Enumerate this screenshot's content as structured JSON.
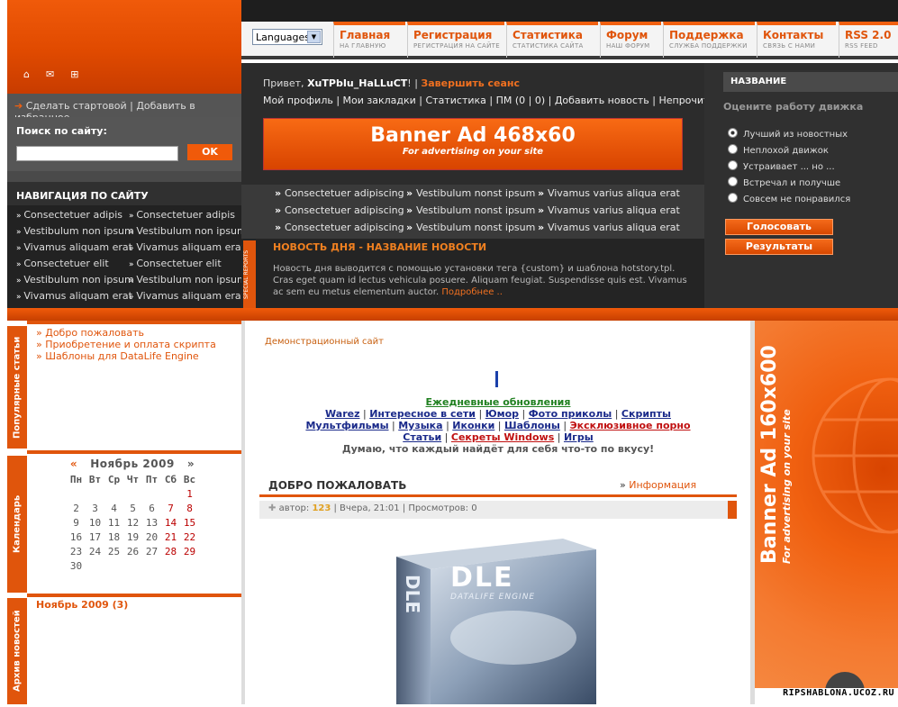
{
  "top_icons": [
    "⌂",
    "✉",
    "⊞"
  ],
  "languages": "Languages",
  "nav": [
    {
      "t": "Главная",
      "s": "НА ГЛАВНУЮ"
    },
    {
      "t": "Регистрация",
      "s": "РЕГИСТРАЦИЯ НА САЙТЕ"
    },
    {
      "t": "Статистика",
      "s": "СТАТИСТИКА САЙТА"
    },
    {
      "t": "Форум",
      "s": "НАШ ФОРУМ"
    },
    {
      "t": "Поддержка",
      "s": "СЛУЖБА ПОДДЕРЖКИ"
    },
    {
      "t": "Контакты",
      "s": "СВЯЗЬ С НАМИ"
    },
    {
      "t": "RSS 2.0",
      "s": "RSS FEED"
    }
  ],
  "fav": {
    "start": "Сделать стартовой",
    "sep": "|",
    "bookmark": "Добавить в избранное"
  },
  "search": {
    "label": "Поиск по сайту:",
    "ok": "OK"
  },
  "left_nav": {
    "title": "НАВИГАЦИЯ ПО САЙТУ",
    "links": [
      "Consectetuer adipis",
      "Consectetuer adipis",
      "Vestibulum non ipsum",
      "Vestibulum non ipsum",
      "Vivamus aliquam erat",
      "Vivamus aliquam erat",
      "Consectetuer elit",
      "Consectetuer elit",
      "Vestibulum non ipsum",
      "Vestibulum non ipsum",
      "Vivamus aliquam erat",
      "Vivamus aliquam erat"
    ]
  },
  "greet": {
    "hello": "Привет, ",
    "user": "XuTPbIu_HaLLuCT",
    "excl": "! | ",
    "logout": "Завершить сеанс"
  },
  "profile_links": "Мой профиль | Мои закладки | Статистика | ПМ (0 | 0) | Добавить новость | Непрочитанное",
  "banner468": {
    "title": "Banner Ad 468x60",
    "sub": "For advertising on your site"
  },
  "link_rows": [
    [
      "Consectetuer adipiscing",
      "Vestibulum nonst ipsum",
      "Vivamus varius aliqua erat"
    ],
    [
      "Consectetuer adipiscing",
      "Vestibulum nonst ipsum",
      "Vivamus varius aliqua erat"
    ],
    [
      "Consectetuer adipiscing",
      "Vestibulum nonst ipsum",
      "Vivamus varius aliqua erat"
    ]
  ],
  "special_tab": "SPECIAL REPORTS",
  "news": {
    "title": "НОВОСТЬ ДНЯ - НАЗВАНИЕ НОВОСТИ",
    "body": "Новость дня выводится с помощью установки тега {custom} и шаблона hotstory.tpl. Cras eget quam id lectus vehicula posuere. Aliquam feugiat. Suspendisse quis est. Vivamus ac sem eu metus elementum auctor. ",
    "more": "Подробнее .."
  },
  "poll": {
    "title": "НАЗВАНИЕ",
    "question": "Оцените работу движка",
    "options": [
      "Лучший из новостных",
      "Неплохой движок",
      "Устраивает ... но ...",
      "Встречал и получше",
      "Совсем не понравился"
    ],
    "vote": "Голосовать",
    "results": "Результаты"
  },
  "popular": {
    "tab": "Популярные статьи",
    "items": [
      "Добро пожаловать",
      "Приобретение и оплата скрипта",
      "Шаблоны для DataLife Engine"
    ]
  },
  "calendar": {
    "tab": "Календарь",
    "prev": "«",
    "month": "Ноябрь 2009",
    "next": "»",
    "days": [
      "Пн",
      "Вт",
      "Ср",
      "Чт",
      "Пт",
      "Сб",
      "Вс"
    ],
    "cells": [
      "",
      "",
      "",
      "",
      "",
      "",
      "1",
      "2",
      "3",
      "4",
      "5",
      "6",
      "7",
      "8",
      "9",
      "10",
      "11",
      "12",
      "13",
      "14",
      "15",
      "16",
      "17",
      "18",
      "19",
      "20",
      "21",
      "22",
      "23",
      "24",
      "25",
      "26",
      "27",
      "28",
      "29",
      "30",
      "",
      "",
      "",
      "",
      "",
      ""
    ]
  },
  "archive": {
    "tab": "Архив новостей",
    "link": "Ноябрь 2009 (3)"
  },
  "demo": "Демонстрационный сайт",
  "today": "Ежедневные обновления",
  "cat_rows": [
    [
      "Warez",
      "Интересное в сети",
      "Юмор",
      "Фото приколы",
      "Скрипты"
    ],
    [
      "Мультфильмы",
      "Музыка",
      "Иконки",
      "Шаблоны",
      "Эксклюзивное порно"
    ],
    [
      "Статьи",
      "Секреты Windows",
      "Игры"
    ]
  ],
  "think": "Думаю, что каждый найдёт для себя что-то по вкусу!",
  "post": {
    "title": "ДОБРО ПОЖАЛОВАТЬ",
    "info": "Информация",
    "meta_author_label": "автор: ",
    "meta_author": "123",
    "meta_rest": " | Вчера, 21:01 | Просмотров: 0"
  },
  "dle": {
    "logo": "DLE",
    "sub": "DATALIFE ENGINE"
  },
  "banner160": {
    "title": "Banner Ad 160x600",
    "sub": "For advertising on your site"
  },
  "footer_url": "RIPSHABLONA.UCOZ.RU",
  "colors": {
    "accent": "#e0550c",
    "dark": "#2c2c2c"
  }
}
